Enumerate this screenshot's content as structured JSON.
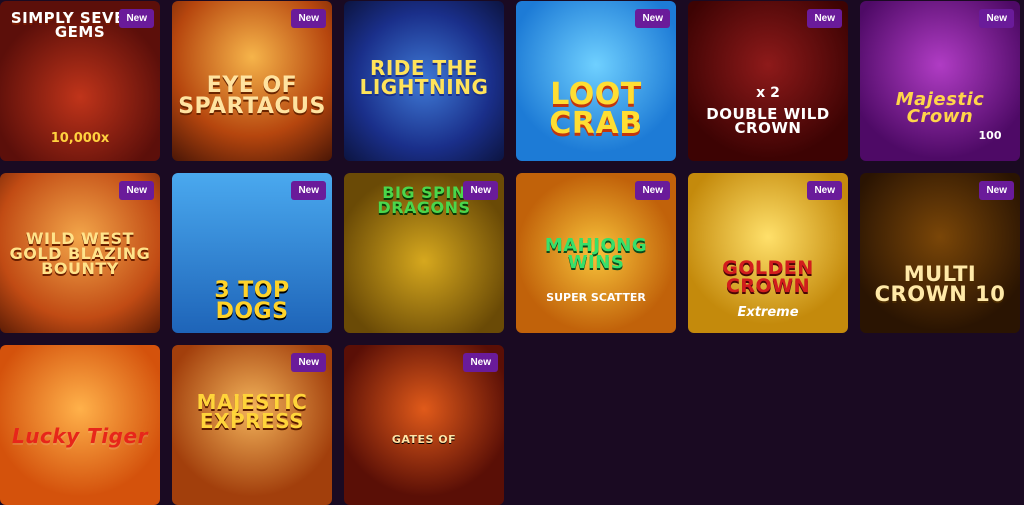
{
  "badge_label": "New",
  "tiles": [
    {
      "title": "SIMPLY SEVENS GEMS",
      "extra": "10,000x",
      "badge": true
    },
    {
      "title": "EYE OF SPARTACUS",
      "extra": "",
      "badge": true
    },
    {
      "title": "RIDE THE LIGHTNING",
      "extra": "",
      "badge": false
    },
    {
      "title": "LOOT CRAB",
      "extra": "",
      "badge": true
    },
    {
      "title": "DOUBLE WILD CROWN",
      "extra": "x 2",
      "badge": true
    },
    {
      "title": "Majestic Crown",
      "extra": "100",
      "badge": true
    },
    {
      "title": "WILD WEST GOLD BLAZING BOUNTY",
      "extra": "",
      "badge": true
    },
    {
      "title": "3 TOP DOGS",
      "extra": "",
      "badge": true
    },
    {
      "title": "BIG SPIN DRAGONS",
      "extra": "",
      "badge": true
    },
    {
      "title": "MAHJONG WINS",
      "extra": "SUPER SCATTER",
      "badge": true
    },
    {
      "title": "GOLDEN CROWN",
      "extra": "Extreme",
      "badge": true
    },
    {
      "title": "MULTI CROWN 10",
      "extra": "",
      "badge": true
    },
    {
      "title": "Lucky Tiger",
      "extra": "",
      "badge": false
    },
    {
      "title": "MAJESTIC EXPRESS",
      "extra": "",
      "badge": true
    },
    {
      "title": "GATES OF",
      "extra": "",
      "badge": true
    }
  ]
}
